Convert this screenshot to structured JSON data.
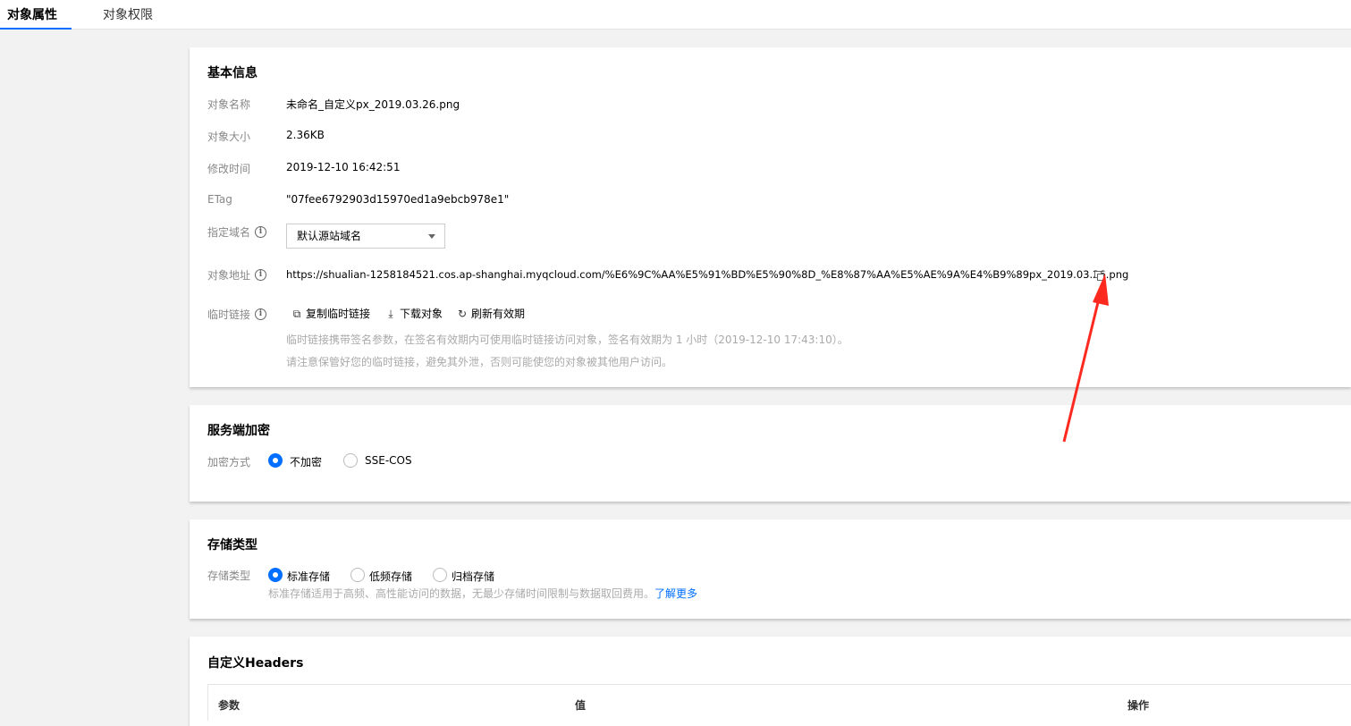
{
  "tabs": [
    {
      "label": "对象属性",
      "active": true
    },
    {
      "label": "对象权限",
      "active": false
    }
  ],
  "basic": {
    "title": "基本信息",
    "name_label": "对象名称",
    "name_value": "未命名_自定义px_2019.03.26.png",
    "size_label": "对象大小",
    "size_value": "2.36KB",
    "mtime_label": "修改时间",
    "mtime_value": "2019-12-10 16:42:51",
    "etag_label": "ETag",
    "etag_value": "\"07fee6792903d15970ed1a9ebcb978e1\"",
    "domain_label": "指定域名",
    "domain_value": "默认源站域名",
    "url_label": "对象地址",
    "url_value": "https://shualian-1258184521.cos.ap-shanghai.myqcloud.com/%E6%9C%AA%E5%91%BD%E5%90%8D_%E8%87%AA%E5%AE%9A%E4%B9%89px_2019.03.26.png",
    "temp_label": "临时链接",
    "actions": {
      "copy_link": "复制临时链接",
      "download": "下载对象",
      "refresh": "刷新有效期"
    },
    "hint1": "临时链接携带签名参数，在签名有效期内可使用临时链接访问对象，签名有效期为 1 小时（2019-12-10 17:43:10）。",
    "hint2": "请注意保管好您的临时链接，避免其外泄，否则可能使您的对象被其他用户访问。"
  },
  "encryption": {
    "title": "服务端加密",
    "label": "加密方式",
    "options": [
      {
        "label": "不加密",
        "checked": true
      },
      {
        "label": "SSE-COS",
        "checked": false
      }
    ]
  },
  "storage": {
    "title": "存储类型",
    "label": "存储类型",
    "options": [
      {
        "label": "标准存储",
        "checked": true
      },
      {
        "label": "低频存储",
        "checked": false
      },
      {
        "label": "归档存储",
        "checked": false
      }
    ],
    "hint": "标准存储适用于高频、高性能访问的数据，无最少存储时间限制与数据取回费用。",
    "link": "了解更多"
  },
  "headers": {
    "title": "自定义Headers",
    "columns": [
      "参数",
      "值",
      "操作"
    ]
  },
  "colors": {
    "accent": "#006eff",
    "annotation_arrow": "#ff2a1f"
  }
}
